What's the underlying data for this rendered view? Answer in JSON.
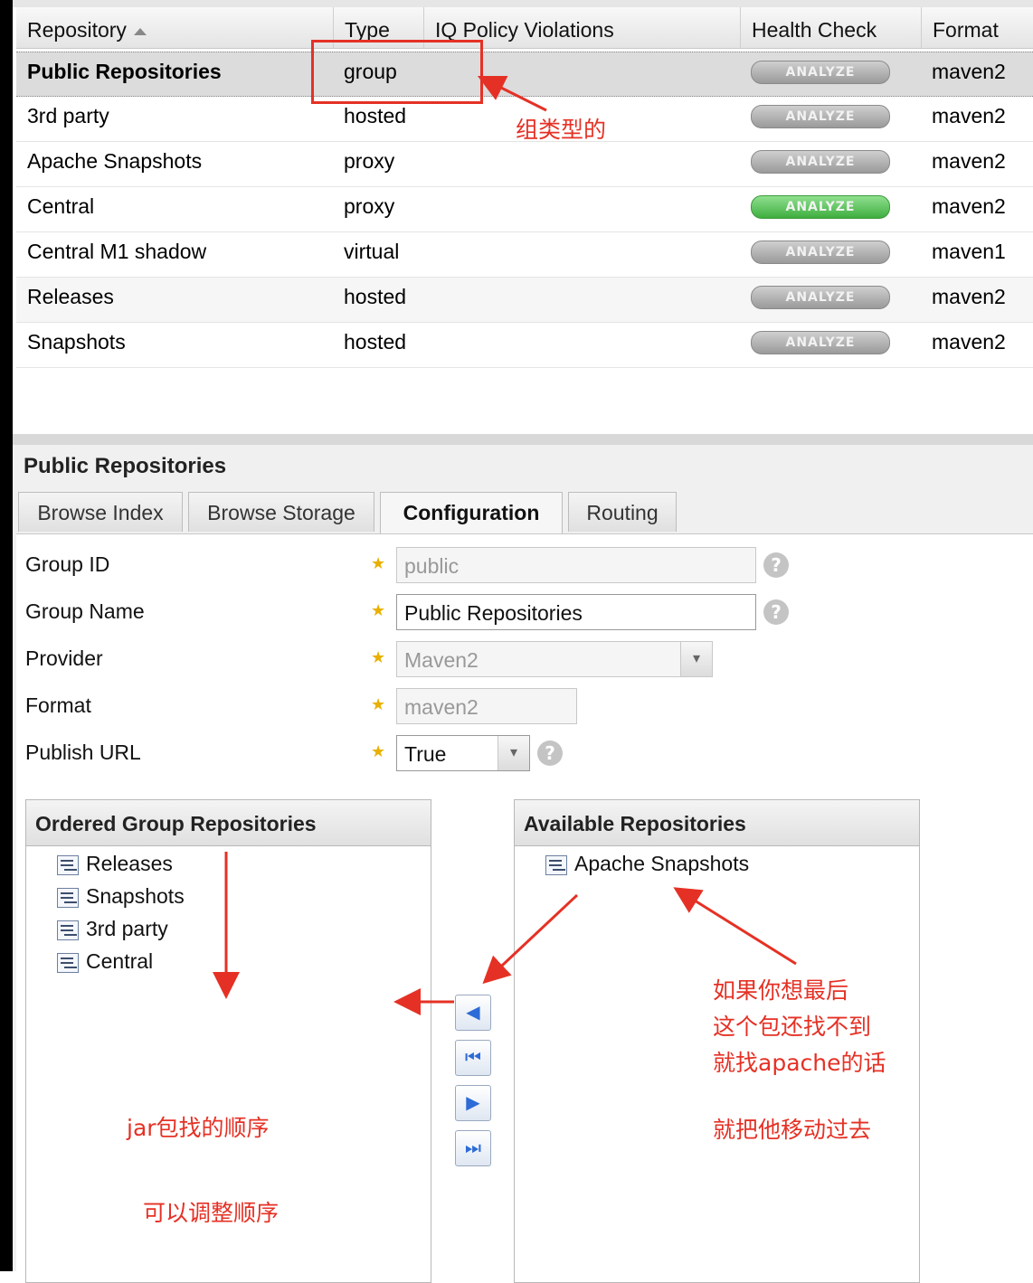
{
  "grid": {
    "columns": {
      "repository": "Repository",
      "type": "Type",
      "iq": "IQ Policy Violations",
      "health": "Health Check",
      "format": "Format"
    },
    "rows": [
      {
        "name": "Public Repositories",
        "type": "group",
        "analyze": "ANALYZE",
        "format": "maven2"
      },
      {
        "name": "3rd party",
        "type": "hosted",
        "analyze": "ANALYZE",
        "format": "maven2"
      },
      {
        "name": "Apache Snapshots",
        "type": "proxy",
        "analyze": "ANALYZE",
        "format": "maven2"
      },
      {
        "name": "Central",
        "type": "proxy",
        "analyze": "ANALYZE",
        "format": "maven2"
      },
      {
        "name": "Central M1 shadow",
        "type": "virtual",
        "analyze": "ANALYZE",
        "format": "maven1"
      },
      {
        "name": "Releases",
        "type": "hosted",
        "analyze": "ANALYZE",
        "format": "maven2"
      },
      {
        "name": "Snapshots",
        "type": "hosted",
        "analyze": "ANALYZE",
        "format": "maven2"
      }
    ]
  },
  "detail": {
    "title": "Public Repositories",
    "tabs": [
      "Browse Index",
      "Browse Storage",
      "Configuration",
      "Routing"
    ],
    "form": {
      "group_id_label": "Group ID",
      "group_id_value": "public",
      "group_name_label": "Group Name",
      "group_name_value": "Public Repositories",
      "provider_label": "Provider",
      "provider_value": "Maven2",
      "format_label": "Format",
      "format_value": "maven2",
      "publish_url_label": "Publish URL",
      "publish_url_value": "True"
    },
    "ordered": {
      "title": "Ordered Group Repositories",
      "items": [
        "Releases",
        "Snapshots",
        "3rd party",
        "Central"
      ]
    },
    "available": {
      "title": "Available Repositories",
      "items": [
        "Apache Snapshots"
      ]
    }
  },
  "annotations": {
    "group_type": "组类型的",
    "if_not_found_1": "如果你想最后",
    "if_not_found_2": "这个包还找不到",
    "if_not_found_3": "就找apache的话",
    "move_it": "就把他移动过去",
    "jar_order": "jar包找的顺序",
    "adjust_order": "可以调整顺序"
  },
  "colors": {
    "annotation_red": "#e53125",
    "analyze_active": "#4cbb4c",
    "analyze_inactive": "#a8a8a8",
    "star": "#e8b000"
  }
}
